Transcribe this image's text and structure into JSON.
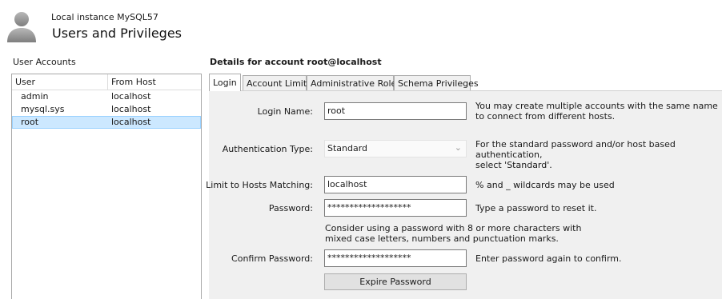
{
  "header": {
    "instance": "Local instance MySQL57",
    "title": "Users and Privileges"
  },
  "accounts": {
    "label": "User Accounts",
    "columns": [
      "User",
      "From Host"
    ],
    "rows": [
      {
        "user": "admin",
        "host": "localhost"
      },
      {
        "user": "mysql.sys",
        "host": "localhost"
      },
      {
        "user": "root",
        "host": "localhost"
      }
    ],
    "selected_index": 2
  },
  "details": {
    "title": "Details for account root@localhost",
    "tabs": [
      "Login",
      "Account Limits",
      "Administrative Roles",
      "Schema Privileges"
    ],
    "active_tab": "Login"
  },
  "login": {
    "login_name_label": "Login Name:",
    "login_name_value": "root",
    "login_name_hint_1": "You may create multiple accounts with the same name",
    "login_name_hint_2": "to connect from different hosts.",
    "auth_type_label": "Authentication Type:",
    "auth_type_value": "Standard",
    "auth_type_hint_1": "For the standard password and/or host based authentication,",
    "auth_type_hint_2": "select 'Standard'.",
    "limit_hosts_label": "Limit to Hosts Matching:",
    "limit_hosts_value": "localhost",
    "limit_hosts_hint": "% and _ wildcards may be used",
    "password_label": "Password:",
    "password_value": "*******************",
    "password_hint": "Type a password to reset it.",
    "password_note_1": "Consider using a password with 8 or more characters with",
    "password_note_2": "mixed case letters, numbers and punctuation marks.",
    "confirm_label": "Confirm Password:",
    "confirm_value": "*******************",
    "confirm_hint": "Enter password again to confirm.",
    "expire_button": "Expire Password"
  },
  "icons": {
    "avatar": "user-avatar-icon",
    "dropdown": "chevron-down-icon"
  }
}
